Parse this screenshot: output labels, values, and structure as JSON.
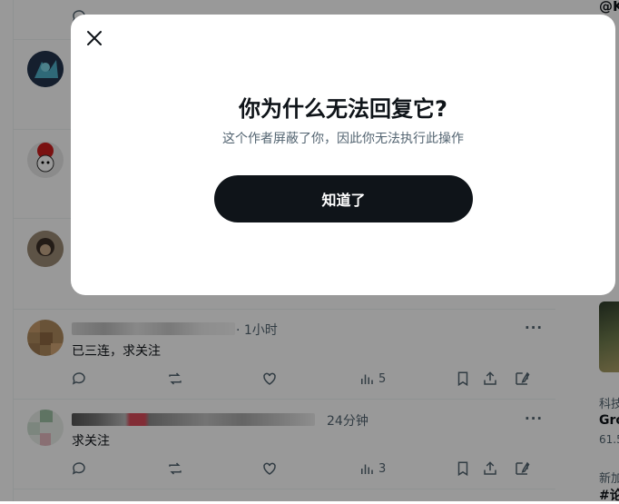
{
  "modal": {
    "title": "你为什么无法回复它?",
    "subtitle": "这个作者屏蔽了你，因此你无法执行此操作",
    "ok_label": "知道了"
  },
  "posts": [
    {
      "time": "· 1小时",
      "text": "已三连，求关注",
      "views": "5"
    },
    {
      "time": "24分钟",
      "text": "求关注",
      "views": "3"
    }
  ],
  "right_rail": {
    "handle_fragment": "@K",
    "trend1_category": "科技",
    "trend1_name": "Gro",
    "trend1_count": "61.5",
    "trend2_category": "新加",
    "trend2_tag": "#论"
  },
  "colors": {
    "overlay": "rgba(0,0,0,0.40)",
    "primary_button": "#0f1419",
    "muted_text": "#536471",
    "divider": "#eff3f4"
  }
}
